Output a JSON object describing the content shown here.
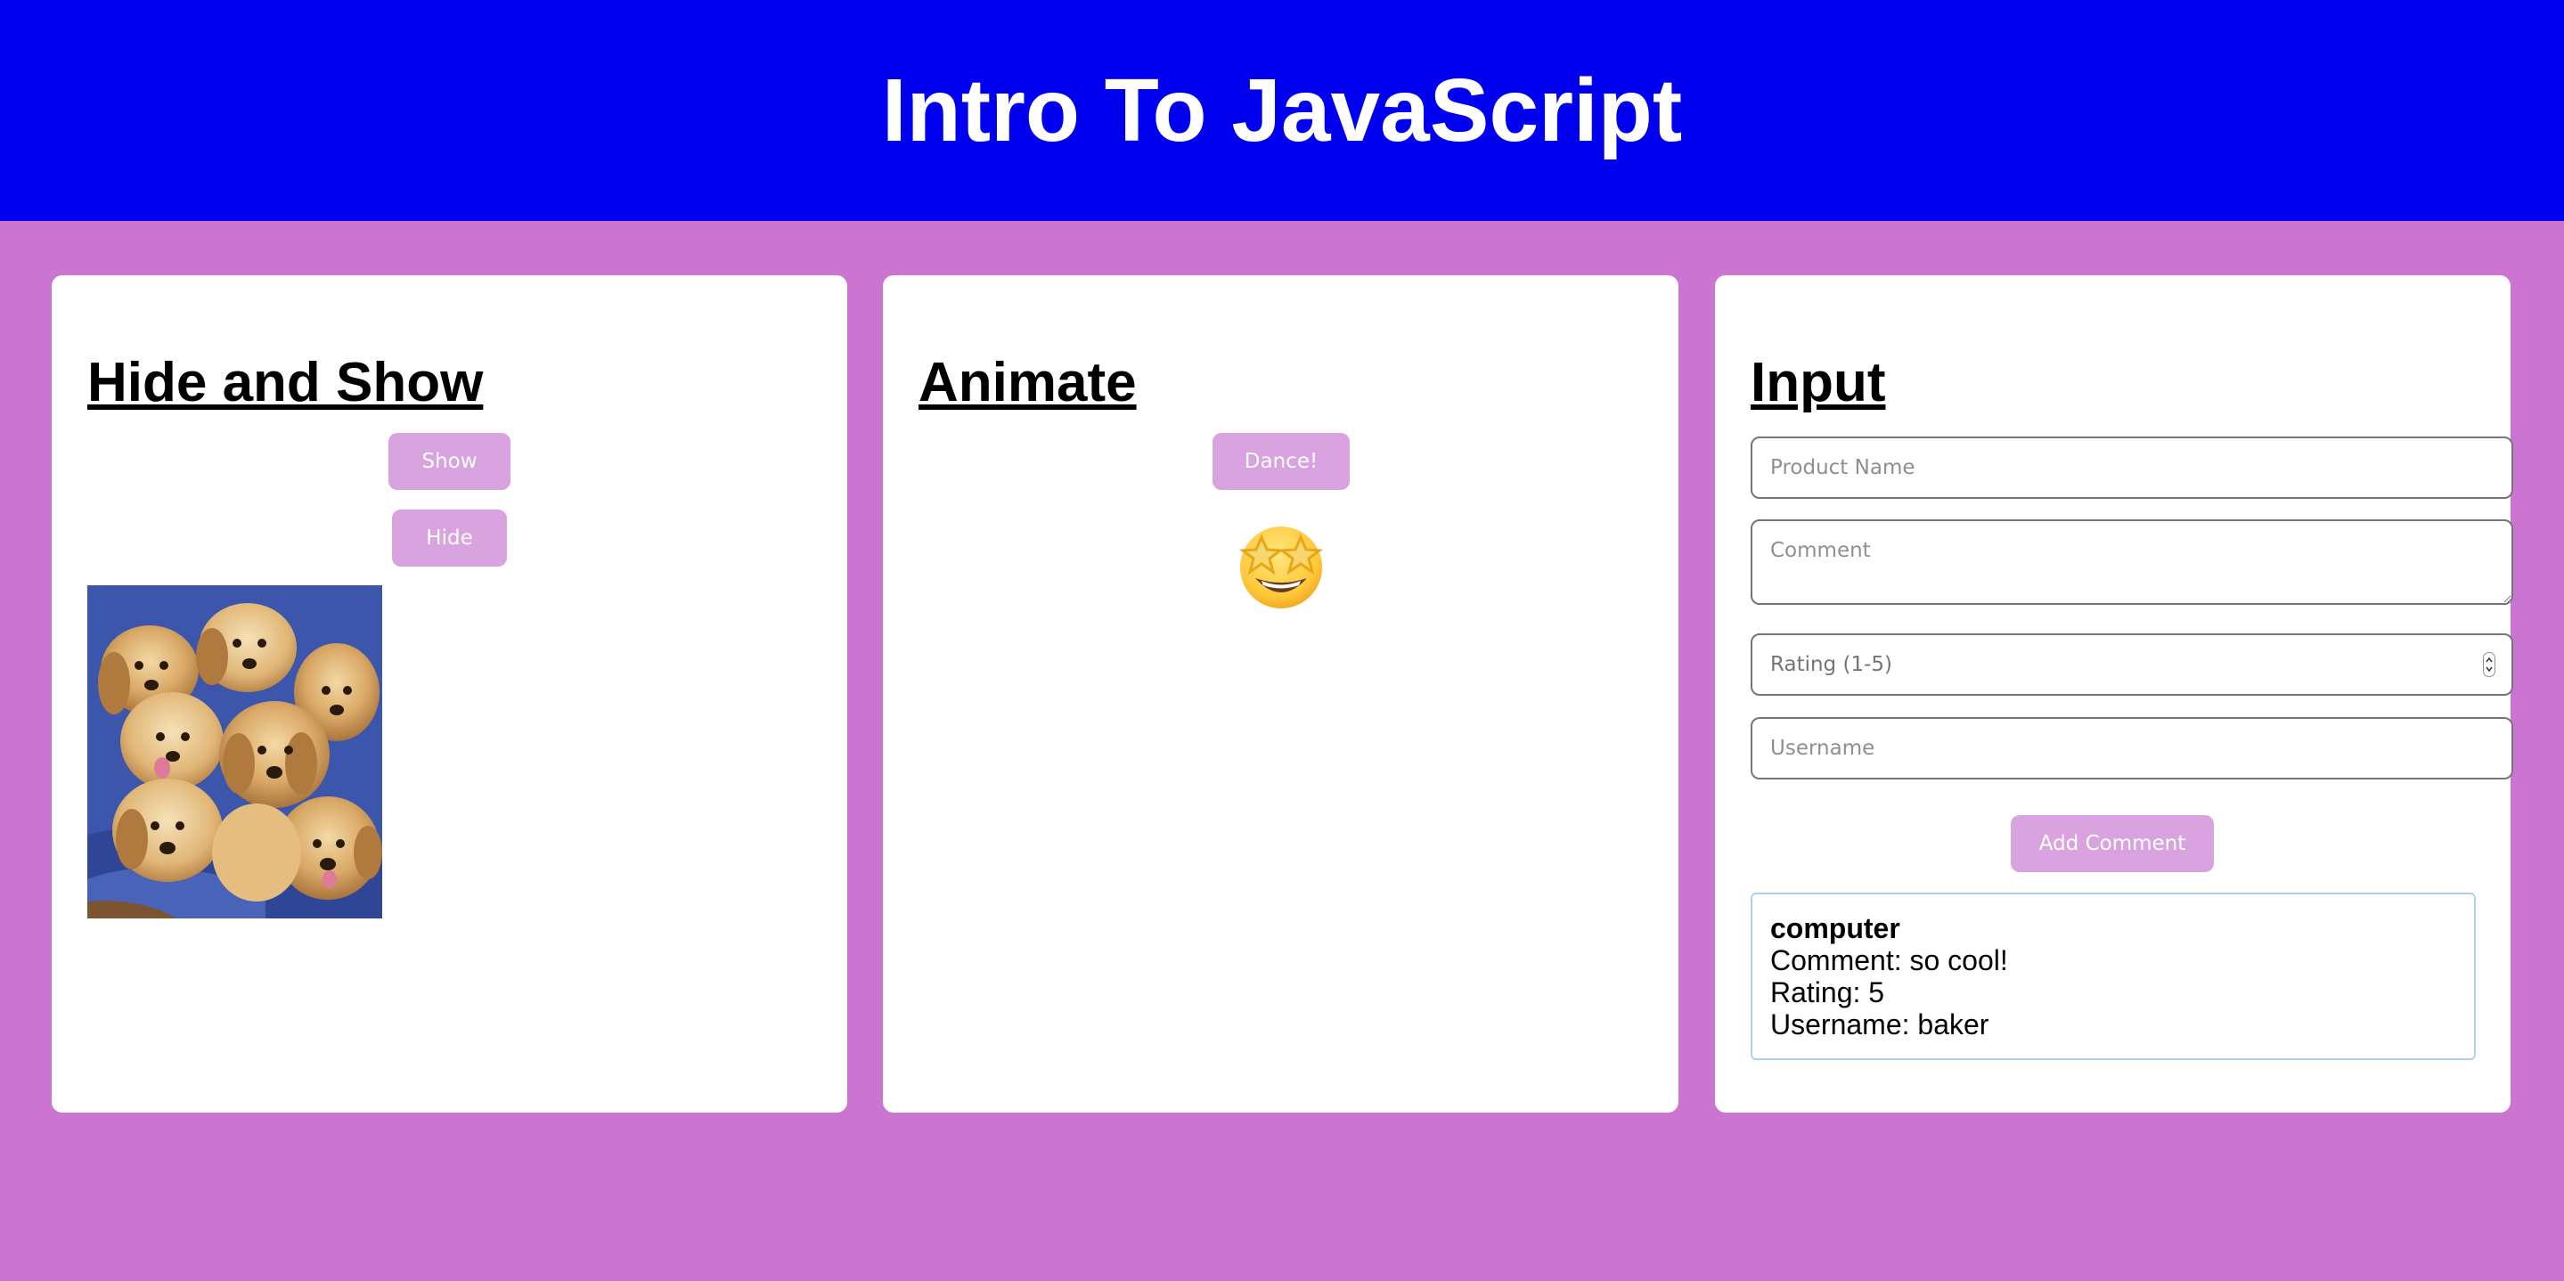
{
  "header": {
    "title": "Intro To JavaScript"
  },
  "colors": {
    "header_bg": "#0000ef",
    "page_bg": "#cc74d1",
    "button_bg": "#d8a3df",
    "card_bg": "#ffffff"
  },
  "hide_show": {
    "heading": "Hide and Show",
    "show_label": "Show",
    "hide_label": "Hide",
    "image_icon": "puppies-photo"
  },
  "animate": {
    "heading": "Animate",
    "dance_label": "Dance!",
    "emoji_icon": "star-struck-emoji"
  },
  "input": {
    "heading": "Input",
    "product_placeholder": "Product Name",
    "comment_placeholder": "Comment",
    "rating_placeholder": "Rating (1-5)",
    "username_placeholder": "Username",
    "add_label": "Add Comment",
    "comments": [
      {
        "product": "computer",
        "comment": "Comment: so cool!",
        "rating": "Rating: 5",
        "username": "Username: baker"
      }
    ]
  }
}
